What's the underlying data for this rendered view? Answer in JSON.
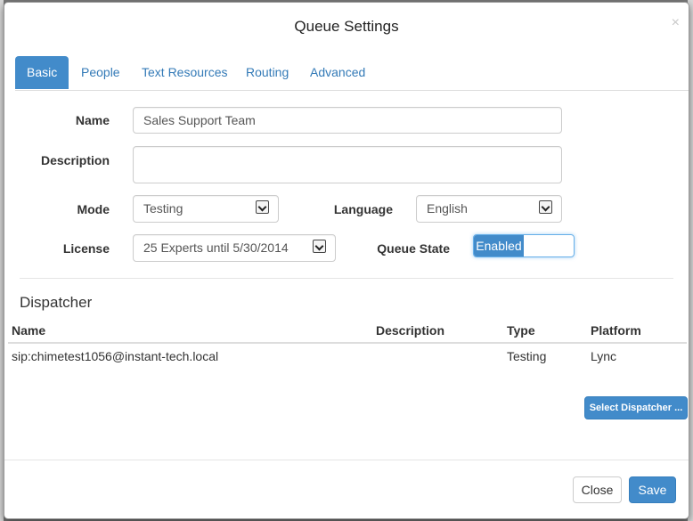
{
  "dialog": {
    "title": "Queue Settings",
    "close_glyph": "×"
  },
  "tabs": [
    {
      "label": "Basic"
    },
    {
      "label": "People"
    },
    {
      "label": "Text Resources"
    },
    {
      "label": "Routing"
    },
    {
      "label": "Advanced"
    }
  ],
  "form": {
    "name_label": "Name",
    "name_value": "Sales Support Team",
    "description_label": "Description",
    "description_value": "",
    "mode_label": "Mode",
    "mode_value": "Testing",
    "language_label": "Language",
    "language_value": "English",
    "license_label": "License",
    "license_value": "25 Experts until 5/30/2014",
    "queue_state_label": "Queue State",
    "queue_state_value": "Enabled"
  },
  "dispatcher": {
    "title": "Dispatcher",
    "columns": [
      "Name",
      "Description",
      "Type",
      "Platform"
    ],
    "rows": [
      {
        "name": "sip:chimetest1056@instant-tech.local",
        "description": "",
        "type": "Testing",
        "platform": "Lync"
      }
    ],
    "select_button": "Select Dispatcher ..."
  },
  "footer": {
    "close_label": "Close",
    "save_label": "Save"
  },
  "colors": {
    "primary": "#428bca",
    "link": "#337ab7"
  }
}
